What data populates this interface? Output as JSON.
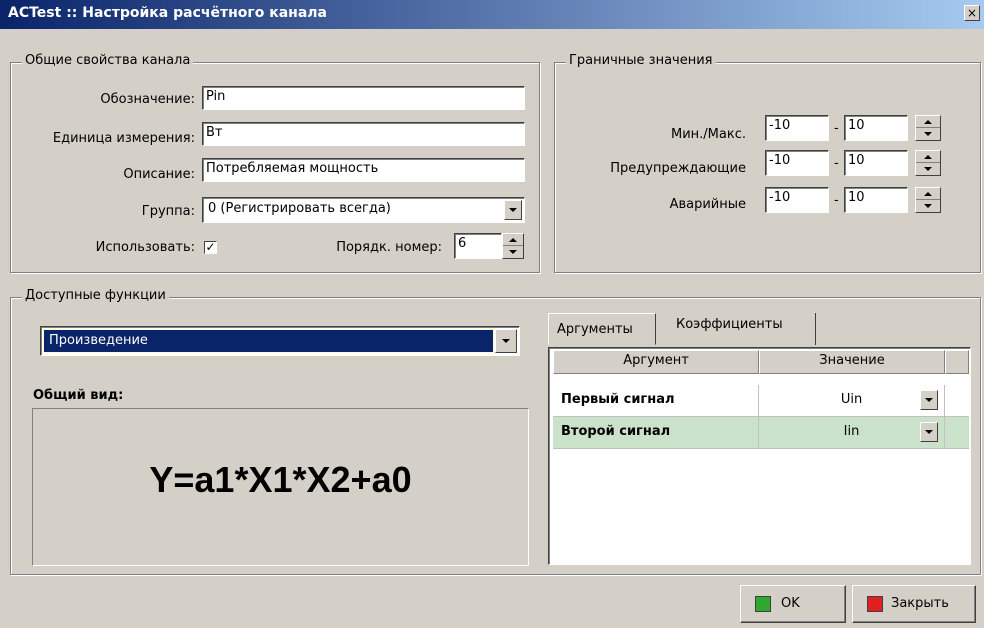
{
  "window": {
    "title": "ACTest :: Настройка расчётного канала",
    "close_glyph": "×"
  },
  "general": {
    "legend": "Общие свойства канала",
    "designation_label": "Обозначение:",
    "designation_value": "Pin",
    "unit_label": "Единица измерения:",
    "unit_value": "Вт",
    "description_label": "Описание:",
    "description_value": "Потребляемая мощность",
    "group_label": "Группа:",
    "group_value": "0 (Регистрировать всегда)",
    "use_label": "Использовать:",
    "use_checked": true,
    "use_check_glyph": "✓",
    "order_label": "Порядк. номер:",
    "order_value": "6"
  },
  "limits": {
    "legend": "Граничные значения",
    "rows": [
      {
        "label": "Мин./Макс.",
        "min": "-10",
        "max": "10",
        "sep": "-"
      },
      {
        "label": "Предупреждающие",
        "min": "-10",
        "max": "10",
        "sep": "-"
      },
      {
        "label": "Аварийные",
        "min": "-10",
        "max": "10",
        "sep": "-"
      }
    ]
  },
  "functions": {
    "legend": "Доступные функции",
    "selected": "Произведение",
    "general_view_label": "Общий вид:",
    "formula": "Y=a1*X1*X2+a0"
  },
  "tabs": [
    {
      "label": "Аргументы",
      "active": true
    },
    {
      "label": "Коэффициенты",
      "active": false
    }
  ],
  "args_table": {
    "columns": [
      "Аргумент",
      "Значение"
    ],
    "rows": [
      {
        "argument": "Первый сигнал",
        "value": "Uin",
        "highlight": false
      },
      {
        "argument": "Второй сигнал",
        "value": "Iin",
        "highlight": true
      }
    ]
  },
  "buttons": {
    "ok": "OK",
    "close": "Закрыть"
  },
  "colors": {
    "title_start": "#0a246a",
    "title_end": "#a6caf0",
    "highlight_row": "#c9e2c9",
    "selection": "#0a246a",
    "ok_icon": "#2ea82e",
    "close_icon": "#e02020"
  }
}
